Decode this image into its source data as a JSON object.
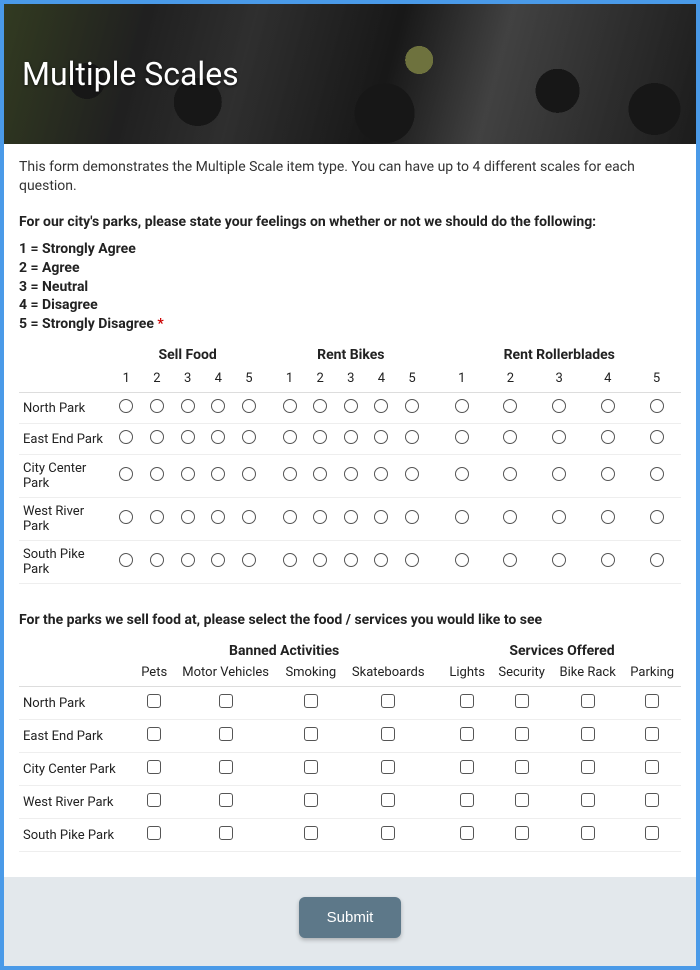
{
  "header": {
    "title": "Multiple Scales"
  },
  "intro": "This form demonstrates the Multiple Scale item type. You can have up to 4 different scales for each question.",
  "q1": {
    "heading": "For our city's parks, please state your feelings on whether or not we should do the following:",
    "legend": [
      "1 = Strongly Agree",
      "2 = Agree",
      "3 = Neutral",
      "4 = Disagree",
      "5 = Strongly Disagree"
    ],
    "required": "*",
    "scales": [
      "Sell Food",
      "Rent Bikes",
      "Rent Rollerblades"
    ],
    "levels": [
      "1",
      "2",
      "3",
      "4",
      "5"
    ],
    "rows": [
      "North Park",
      "East End Park",
      "City Center Park",
      "West River Park",
      "South Pike Park"
    ]
  },
  "q2": {
    "heading": "For the parks we sell food at, please select the food / services you would like to see",
    "groups": [
      "Banned Activities",
      "Services Offered"
    ],
    "cols_a": [
      "Pets",
      "Motor Vehicles",
      "Smoking",
      "Skateboards"
    ],
    "cols_b": [
      "Lights",
      "Security",
      "Bike Rack",
      "Parking"
    ],
    "rows": [
      "North Park",
      "East End Park",
      "City Center Park",
      "West River Park",
      "South Pike Park"
    ]
  },
  "submit": {
    "label": "Submit"
  }
}
